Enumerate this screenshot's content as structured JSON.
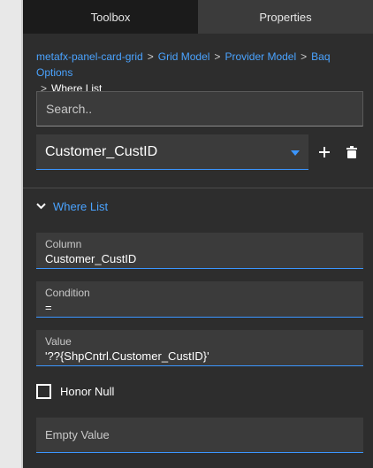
{
  "tabs": [
    {
      "label": "Toolbox",
      "active": true
    },
    {
      "label": "Properties",
      "active": false
    }
  ],
  "breadcrumb": {
    "items": [
      "metafx-panel-card-grid",
      "Grid Model",
      "Provider Model",
      "Baq Options"
    ],
    "separator": ">",
    "current": "Where List"
  },
  "search": {
    "placeholder": "Search.."
  },
  "selector": {
    "value": "Customer_CustID",
    "icons": [
      "plus-icon",
      "trash-icon"
    ]
  },
  "section": {
    "title": "Where List",
    "expanded": true
  },
  "fields": {
    "column": {
      "label": "Column",
      "value": "Customer_CustID"
    },
    "condition": {
      "label": "Condition",
      "value": "="
    },
    "value": {
      "label": "Value",
      "value": "'??{ShpCntrl.Customer_CustID}'"
    }
  },
  "honor_null": {
    "label": "Honor Null",
    "checked": false
  },
  "empty_value": {
    "label": "Empty Value",
    "value": ""
  },
  "colors": {
    "accent": "#3b96ff",
    "link": "#4aa3ff",
    "panel_bg": "#2d2d2d",
    "field_bg": "#3b3b3b",
    "active_tab_bg": "#1b1b1b"
  }
}
